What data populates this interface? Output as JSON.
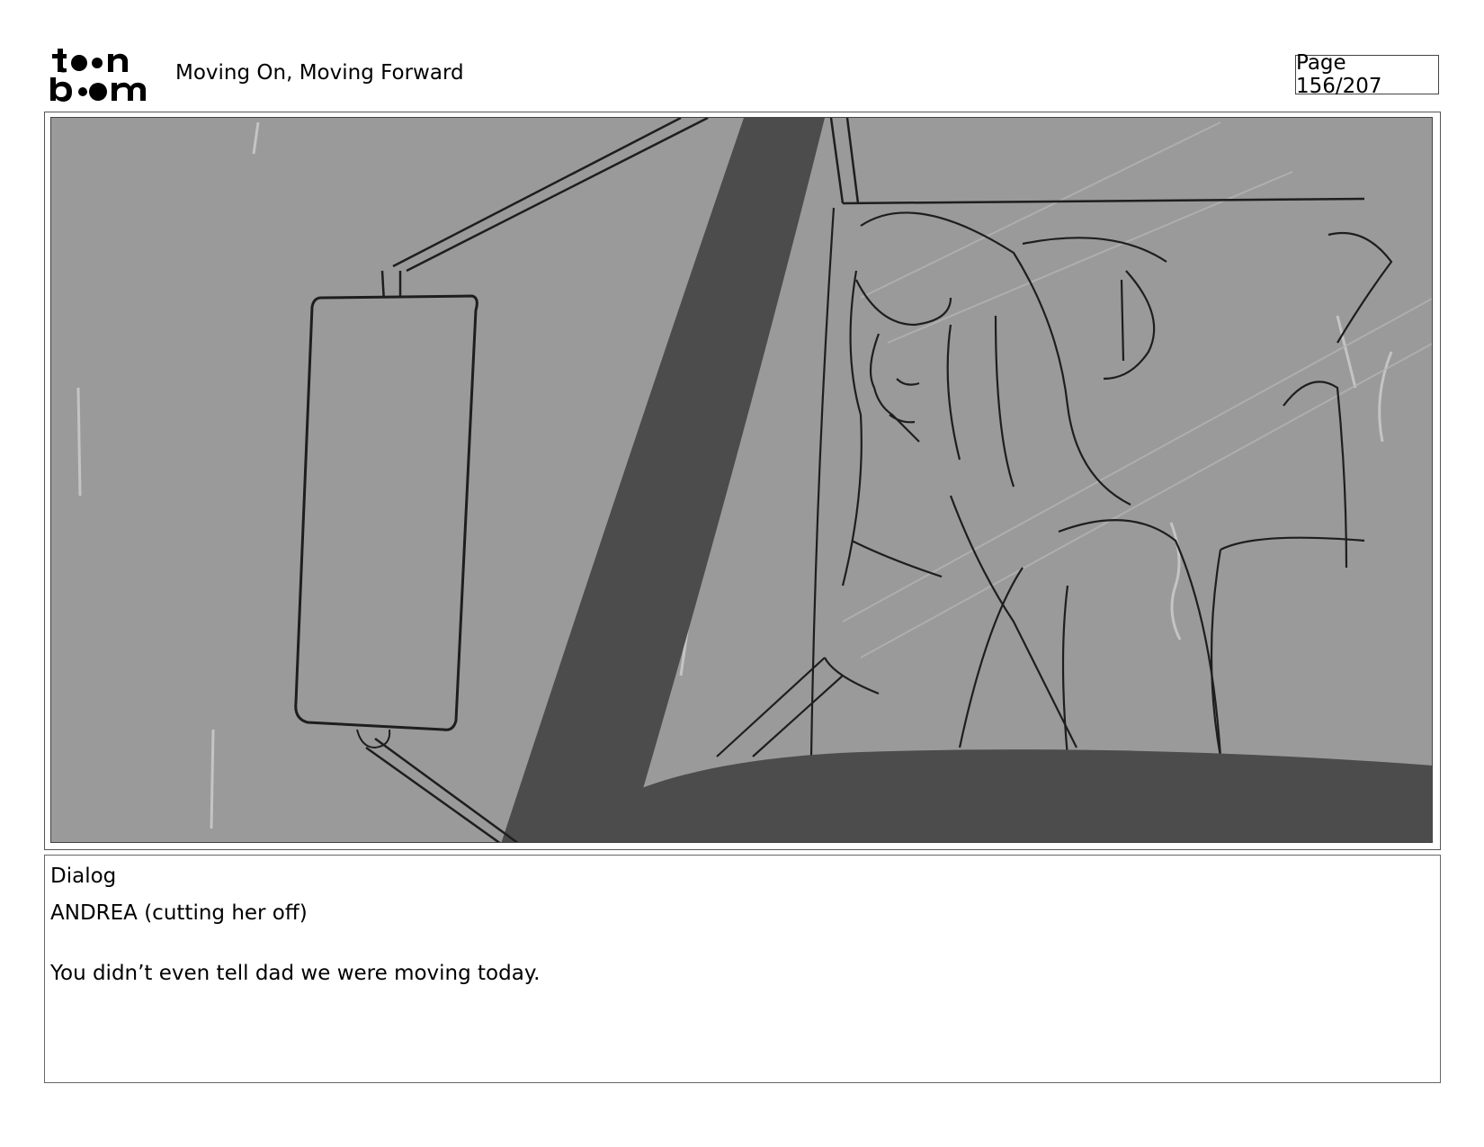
{
  "header": {
    "logo_text": "toonboom",
    "title": "Moving On, Moving Forward",
    "page": "Page 156/207"
  },
  "panel": {
    "image_kind": "storyboard-sketch"
  },
  "dialog": {
    "header": "Dialog",
    "speaker": "ANDREA (cutting her off)",
    "line": "You didn’t even tell dad we were moving today."
  }
}
